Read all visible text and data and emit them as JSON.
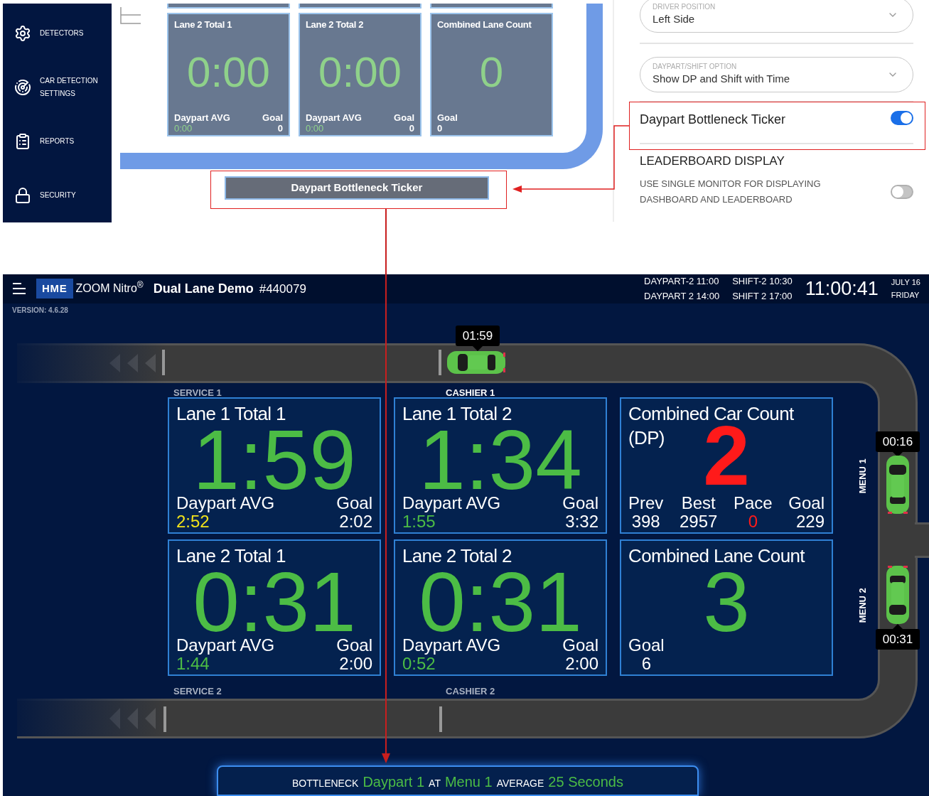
{
  "settings_preview": {
    "sidebar": {
      "items": [
        {
          "label": "DETECTORS"
        },
        {
          "label": "CAR DETECTION SETTINGS"
        },
        {
          "label": "REPORTS"
        },
        {
          "label": "SECURITY"
        }
      ]
    },
    "tiles": [
      {
        "kind": "timer",
        "title": "Lane 2 Total 1",
        "value": "0:00",
        "color": "#8fd18a",
        "stats": [
          {
            "label": "Daypart AVG",
            "value": "0:00",
            "color": "#8fd18a"
          },
          {
            "label": "Goal",
            "value": "0",
            "color": "#ffffff"
          }
        ]
      },
      {
        "kind": "timer",
        "title": "Lane 2 Total 2",
        "value": "0:00",
        "color": "#8fd18a",
        "stats": [
          {
            "label": "Daypart AVG",
            "value": "0:00",
            "color": "#8fd18a"
          },
          {
            "label": "Goal",
            "value": "0",
            "color": "#ffffff"
          }
        ]
      },
      {
        "kind": "count",
        "title": "Combined Lane Count",
        "value": "0",
        "color": "#8fd18a",
        "stats": [
          {
            "label": "Goal",
            "value": "0",
            "color": "#ffffff"
          }
        ]
      }
    ],
    "ticker": "Daypart Bottleneck Ticker"
  },
  "settings": {
    "fields": [
      {
        "label": "DRIVER POSITION",
        "value": "Left Side"
      },
      {
        "label": "DAYPART/SHIFT OPTION",
        "value": "Show DP and Shift with Time"
      }
    ],
    "ticker_toggle": {
      "label": "Daypart Bottleneck Ticker",
      "on": true
    },
    "leaderboard": {
      "heading": "LEADERBOARD DISPLAY",
      "label": "USE SINGLE MONITOR FOR DISPLAYING DASHBOARD AND LEADERBOARD",
      "on": false
    }
  },
  "dashboard": {
    "header": {
      "logo": "HME",
      "product": "ZOOM Nitro$^{®}$",
      "store": "Dual Lane Demo",
      "store_number": "#440079",
      "schedule": [
        {
          "name": "DAYPART-2",
          "time": "11:00"
        },
        {
          "name": "SHIFT-2",
          "time": "10:30"
        },
        {
          "name": "DAYPART 2",
          "time": "14:00"
        },
        {
          "name": "SHIFT 2",
          "time": "17:00"
        }
      ],
      "time": "11:00:41",
      "date": "JULY 16",
      "day": "FRIDAY"
    },
    "version": "VERSION: 4.6.28",
    "cars": [
      {
        "time": "01:59"
      },
      {
        "time": "00:16"
      },
      {
        "time": "00:31"
      }
    ],
    "lane_labels": [
      "SERVICE 1",
      "CASHIER 1",
      "SERVICE 2",
      "CASHIER 2",
      "MENU 1",
      "MENU 2"
    ],
    "tiles": [
      {
        "kind": "timer",
        "title": "Lane 1 Total 1",
        "value": "1:59",
        "color": "#4cbc45",
        "stats": [
          {
            "label": "Daypart AVG",
            "value": "2:52",
            "color": "#f2e21a"
          },
          {
            "label": "Goal",
            "value": "2:02",
            "color": "#ffffff"
          }
        ]
      },
      {
        "kind": "timer",
        "title": "Lane 1 Total 2",
        "value": "1:34",
        "color": "#4cbc45",
        "stats": [
          {
            "label": "Daypart AVG",
            "value": "1:55",
            "color": "#4cbc45"
          },
          {
            "label": "Goal",
            "value": "3:32",
            "color": "#ffffff"
          }
        ]
      },
      {
        "kind": "count",
        "title": "Combined Car Count (DP)",
        "value": "2",
        "color": "#ff1a1a",
        "stats": [
          {
            "label": "Prev",
            "value": "398",
            "color": "#ffffff"
          },
          {
            "label": "Best",
            "value": "2957",
            "color": "#ffffff"
          },
          {
            "label": "Pace",
            "value": "0",
            "color": "#ff1a1a"
          },
          {
            "label": "Goal",
            "value": "229",
            "color": "#ffffff"
          }
        ]
      },
      {
        "kind": "timer",
        "title": "Lane 2 Total 1",
        "value": "0:31",
        "color": "#4cbc45",
        "stats": [
          {
            "label": "Daypart AVG",
            "value": "1:44",
            "color": "#4cbc45"
          },
          {
            "label": "Goal",
            "value": "2:00",
            "color": "#ffffff"
          }
        ]
      },
      {
        "kind": "timer",
        "title": "Lane 2 Total 2",
        "value": "0:31",
        "color": "#4cbc45",
        "stats": [
          {
            "label": "Daypart AVG",
            "value": "0:52",
            "color": "#4cbc45"
          },
          {
            "label": "Goal",
            "value": "2:00",
            "color": "#ffffff"
          }
        ]
      },
      {
        "kind": "count",
        "title": "Combined Lane Count",
        "value": "3",
        "color": "#4cbc45",
        "stats": [
          {
            "label": "Goal",
            "value": "6",
            "color": "#ffffff"
          }
        ]
      }
    ],
    "ticker": [
      {
        "kind": "label",
        "text": "BOTTLENECK"
      },
      {
        "kind": "value",
        "text": "Daypart 1"
      },
      {
        "kind": "label",
        "text": "AT"
      },
      {
        "kind": "value",
        "text": "Menu 1"
      },
      {
        "kind": "label",
        "text": "AVERAGE"
      },
      {
        "kind": "value",
        "text": "25 Seconds"
      }
    ]
  }
}
